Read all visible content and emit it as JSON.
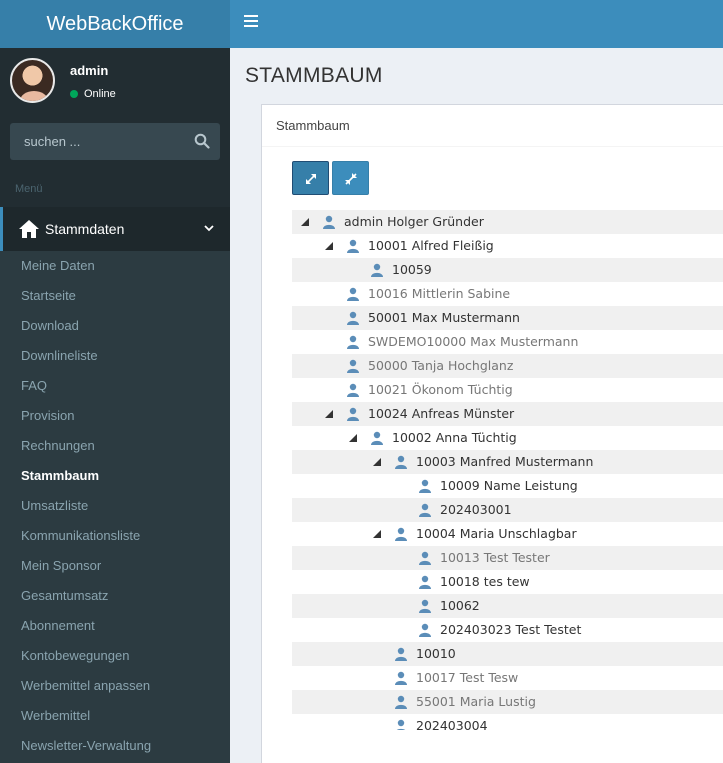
{
  "app": {
    "title": "WebBackOffice"
  },
  "user": {
    "name": "admin",
    "status": "Online"
  },
  "search": {
    "placeholder": "suchen ..."
  },
  "menu": {
    "header": "Menü",
    "active_section": "Stammdaten",
    "items": [
      {
        "label": "Meine Daten",
        "active": false
      },
      {
        "label": "Startseite",
        "active": false
      },
      {
        "label": "Download",
        "active": false
      },
      {
        "label": "Downlineliste",
        "active": false
      },
      {
        "label": "FAQ",
        "active": false
      },
      {
        "label": "Provision",
        "active": false
      },
      {
        "label": "Rechnungen",
        "active": false
      },
      {
        "label": "Stammbaum",
        "active": true
      },
      {
        "label": "Umsatzliste",
        "active": false
      },
      {
        "label": "Kommunikationsliste",
        "active": false
      },
      {
        "label": "Mein Sponsor",
        "active": false
      },
      {
        "label": "Gesamtumsatz",
        "active": false
      },
      {
        "label": "Abonnement",
        "active": false
      },
      {
        "label": "Kontobewegungen",
        "active": false
      },
      {
        "label": "Werbemittel anpassen",
        "active": false
      },
      {
        "label": "Werbemittel",
        "active": false
      },
      {
        "label": "Newsletter-Verwaltung",
        "active": false
      }
    ]
  },
  "page": {
    "title": "STAMMBAUM",
    "box_title": "Stammbaum"
  },
  "icons": {
    "home": "home-icon",
    "search": "search-icon",
    "chevron": "chevron-down-icon",
    "expand": "expand-icon",
    "collapse": "collapse-icon",
    "person": "user-icon",
    "menu": "hamburger-icon"
  },
  "colors": {
    "brand": "#3c8dbc",
    "sidebar": "#222d32",
    "status_online": "#00a65a"
  },
  "tree": [
    {
      "label": "admin Holger Gründer",
      "level": 0,
      "expanded": true,
      "muted": false
    },
    {
      "label": "10001 Alfred Fleißig",
      "level": 1,
      "expanded": true,
      "muted": false
    },
    {
      "label": "10059",
      "level": 2,
      "expanded": null,
      "muted": false
    },
    {
      "label": "10016 Mittlerin Sabine",
      "level": 1,
      "expanded": null,
      "muted": true
    },
    {
      "label": "50001 Max Mustermann",
      "level": 1,
      "expanded": null,
      "muted": false
    },
    {
      "label": "SWDEMO10000 Max Mustermann",
      "level": 1,
      "expanded": null,
      "muted": true
    },
    {
      "label": "50000 Tanja Hochglanz",
      "level": 1,
      "expanded": null,
      "muted": true
    },
    {
      "label": "10021 Ökonom Tüchtig",
      "level": 1,
      "expanded": null,
      "muted": true
    },
    {
      "label": "10024 Anfreas Münster",
      "level": 1,
      "expanded": true,
      "muted": false
    },
    {
      "label": "10002 Anna Tüchtig",
      "level": 2,
      "expanded": true,
      "muted": false
    },
    {
      "label": "10003 Manfred Mustermann",
      "level": 3,
      "expanded": true,
      "muted": false
    },
    {
      "label": "10009 Name Leistung",
      "level": 4,
      "expanded": null,
      "muted": false
    },
    {
      "label": "202403001",
      "level": 4,
      "expanded": null,
      "muted": false
    },
    {
      "label": "10004 Maria Unschlagbar",
      "level": 3,
      "expanded": true,
      "muted": false
    },
    {
      "label": "10013 Test Tester",
      "level": 4,
      "expanded": null,
      "muted": true
    },
    {
      "label": "10018 tes tew",
      "level": 4,
      "expanded": null,
      "muted": false
    },
    {
      "label": "10062",
      "level": 4,
      "expanded": null,
      "muted": false
    },
    {
      "label": "202403023 Test Testet",
      "level": 4,
      "expanded": null,
      "muted": false
    },
    {
      "label": "10010",
      "level": 3,
      "expanded": null,
      "muted": false
    },
    {
      "label": "10017 Test Tesw",
      "level": 3,
      "expanded": null,
      "muted": true
    },
    {
      "label": "55001 Maria Lustig",
      "level": 3,
      "expanded": null,
      "muted": true
    },
    {
      "label": "202403004",
      "level": 3,
      "expanded": null,
      "muted": false
    }
  ]
}
